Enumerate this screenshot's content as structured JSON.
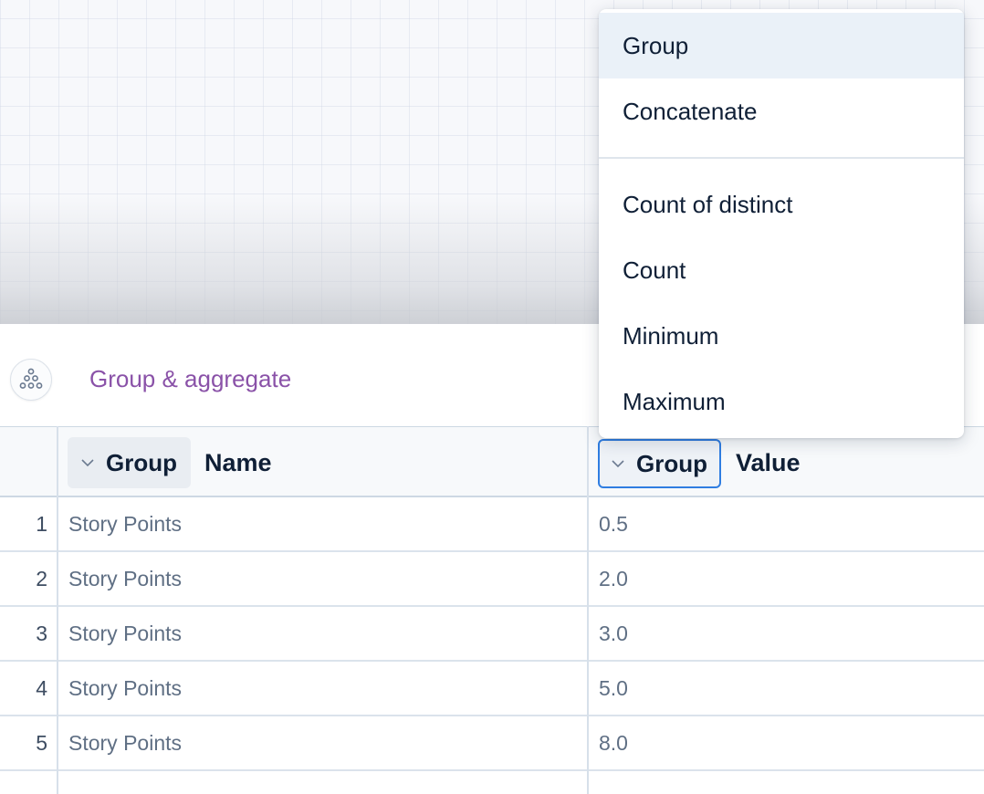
{
  "step": {
    "title": "Group & aggregate",
    "icon": "group-aggregate-icon"
  },
  "table": {
    "columns": [
      {
        "aggregation": "Group",
        "title": "Name"
      },
      {
        "aggregation": "Group",
        "title": "Value"
      }
    ],
    "rows": [
      {
        "index": "1",
        "name": "Story Points",
        "value": "0.5"
      },
      {
        "index": "2",
        "name": "Story Points",
        "value": "2.0"
      },
      {
        "index": "3",
        "name": "Story Points",
        "value": "3.0"
      },
      {
        "index": "4",
        "name": "Story Points",
        "value": "5.0"
      },
      {
        "index": "5",
        "name": "Story Points",
        "value": "8.0"
      }
    ]
  },
  "menu": {
    "selected": "Group",
    "items": [
      {
        "label": "Group"
      },
      {
        "label": "Concatenate"
      },
      {
        "label": "Count of distinct"
      },
      {
        "label": "Count"
      },
      {
        "label": "Minimum"
      },
      {
        "label": "Maximum"
      }
    ]
  },
  "colors": {
    "accent": "#2f7de1",
    "title": "#8a52a8",
    "menu_active": "#eaf1f8"
  }
}
